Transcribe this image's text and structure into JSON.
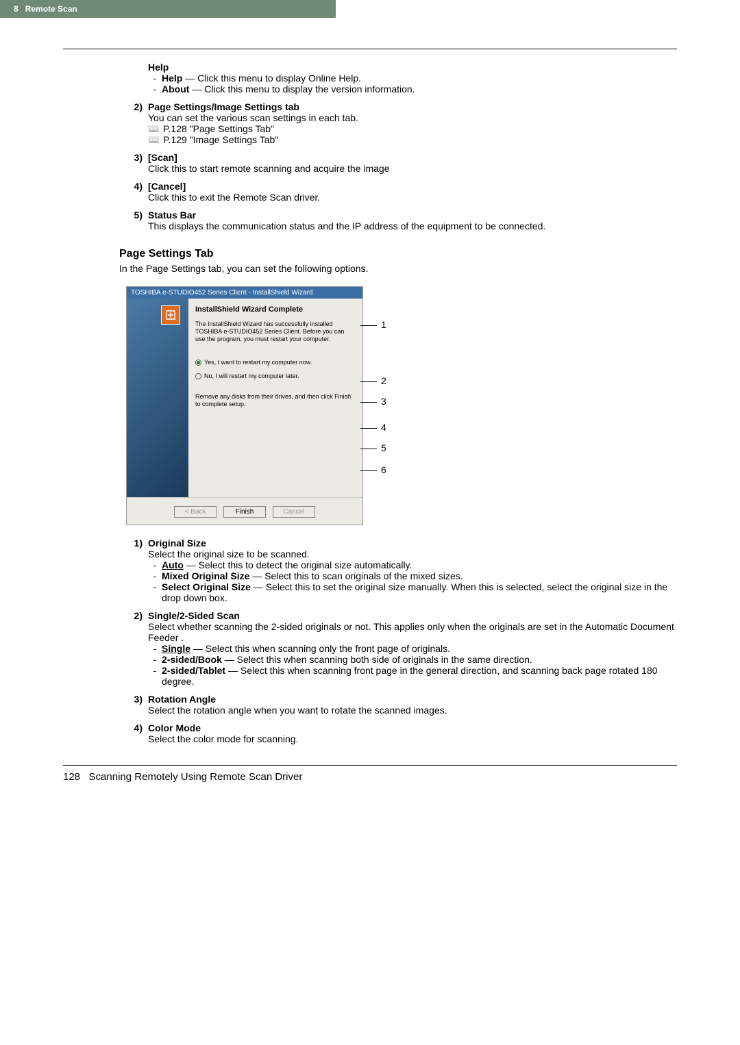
{
  "header": {
    "chapter_num": "8",
    "chapter_title": "Remote Scan"
  },
  "help_block": {
    "title": "Help",
    "items": [
      {
        "label": "Help",
        "desc": " — Click this menu to display Online Help."
      },
      {
        "label": "About",
        "desc": " — Click this menu to display the version information."
      }
    ]
  },
  "numbered_top": [
    {
      "num": "2)",
      "title": "Page Settings/Image Settings tab",
      "desc": "You can set the various scan settings in each tab.",
      "refs": [
        "P.128 \"Page Settings Tab\"",
        "P.129 \"Image Settings Tab\""
      ]
    },
    {
      "num": "3)",
      "title": "[Scan]",
      "desc": "Click this to start remote scanning and acquire the image"
    },
    {
      "num": "4)",
      "title": "[Cancel]",
      "desc": "Click this to exit the Remote Scan driver."
    },
    {
      "num": "5)",
      "title": "Status Bar",
      "desc": "This displays the communication status and the IP address of the equipment to be connected."
    }
  ],
  "section": {
    "title": "Page Settings Tab",
    "desc": "In the Page Settings tab, you can set the following options."
  },
  "installshield": {
    "title": "TOSHIBA e-STUDIO452 Series Client - InstallShield Wizard",
    "heading": "InstallShield Wizard Complete",
    "para": "The InstallShield Wizard has successfully installed TOSHIBA e-STUDIO452 Series Client. Before you can use the program, you must restart your computer.",
    "opt_yes": "Yes, I want to restart my computer now.",
    "opt_no": "No, I will restart my computer later.",
    "note": "Remove any disks from their drives, and then click Finish to complete setup.",
    "btn_back": "< Back",
    "btn_finish": "Finish",
    "btn_cancel": "Cancel"
  },
  "callout_labels": {
    "c1": "1",
    "c2": "2",
    "c3": "3",
    "c4": "4",
    "c5": "5",
    "c6": "6"
  },
  "numbered_bottom": [
    {
      "num": "1)",
      "title": "Original Size",
      "desc": "Select the original size to be scanned.",
      "items": [
        {
          "label": "Auto",
          "underline": true,
          "desc": " — Select this to detect the original size automatically."
        },
        {
          "label": "Mixed Original Size",
          "underline": false,
          "desc": " — Select this to scan originals of the mixed sizes."
        },
        {
          "label": "Select Original Size",
          "underline": false,
          "desc": " — Select this to set the original size manually.  When this is selected, select the original size in the drop down box."
        }
      ]
    },
    {
      "num": "2)",
      "title": "Single/2-Sided Scan",
      "desc": "Select whether scanning the 2-sided originals or not.  This applies only when the originals are set in the Automatic Document Feeder .",
      "items": [
        {
          "label": "Single",
          "underline": true,
          "desc": " — Select this when scanning only the front page of originals."
        },
        {
          "label": "2-sided/Book",
          "underline": false,
          "desc": " — Select this when scanning both side of originals in the same direction."
        },
        {
          "label": "2-sided/Tablet",
          "underline": false,
          "desc": " — Select this when scanning front page in the general direction, and scanning back page rotated 180 degree."
        }
      ]
    },
    {
      "num": "3)",
      "title": "Rotation Angle",
      "desc": "Select the rotation angle when you want to rotate the scanned images."
    },
    {
      "num": "4)",
      "title": "Color Mode",
      "desc": "Select the color mode for scanning."
    }
  ],
  "footer": {
    "page_num": "128",
    "footer_text": "Scanning Remotely Using Remote Scan Driver"
  }
}
